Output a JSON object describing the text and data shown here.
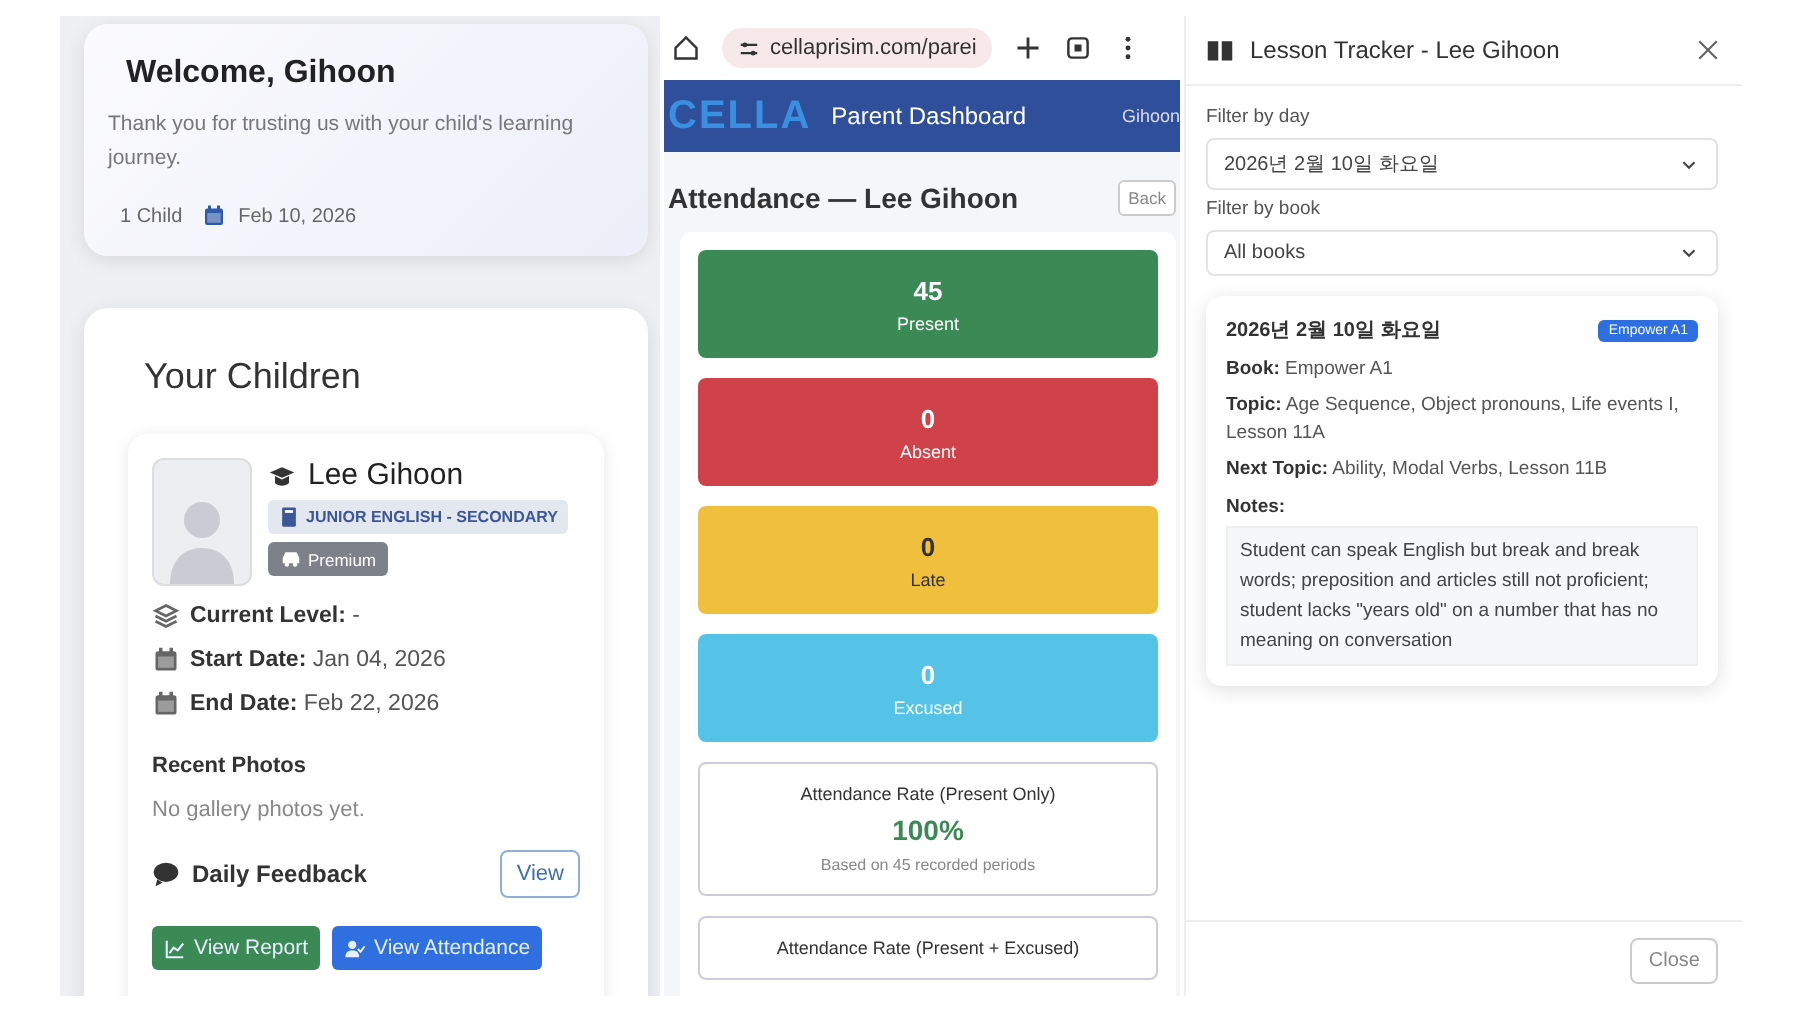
{
  "welcome": {
    "title": "Welcome, Gihoon",
    "message": "Thank you for trusting us with your child's learning journey.",
    "child_count": "1 Child",
    "date": "Feb 10, 2026"
  },
  "children": {
    "title": "Your Children",
    "child": {
      "name": "Lee Gihoon",
      "program": "JUNIOR ENGLISH - SECONDARY",
      "plan": "Premium",
      "details": [
        {
          "label": "Current Level:",
          "value": "-"
        },
        {
          "label": "Start Date:",
          "value": "Jan 04, 2026"
        },
        {
          "label": "End Date:",
          "value": "Feb 22, 2026"
        }
      ],
      "photos_title": "Recent Photos",
      "photos_empty": "No gallery photos yet.",
      "feedback_title": "Daily Feedback",
      "feedback_button": "View",
      "buttons": [
        {
          "label": "View Report",
          "color": "#3b8a55"
        },
        {
          "label": "View Attendance",
          "color": "#2f6fe0"
        }
      ]
    }
  },
  "browser": {
    "url": "cellaprisim.com/parei"
  },
  "app_header": {
    "logo": "CELLA",
    "title": "Parent Dashboard",
    "user": "Gihoon"
  },
  "attendance": {
    "title": "Attendance — Lee Gihoon",
    "back": "Back",
    "stats": [
      {
        "count": "45",
        "label": "Present",
        "color": "#3b8a55"
      },
      {
        "count": "0",
        "label": "Absent",
        "color": "#cf4249"
      },
      {
        "count": "0",
        "label": "Late",
        "color": "#f0bf3c"
      },
      {
        "count": "0",
        "label": "Excused",
        "color": "#55c3e8"
      }
    ],
    "rates": [
      {
        "title": "Attendance Rate (Present Only)",
        "value": "100%",
        "note": "Based on 45 recorded periods"
      },
      {
        "title": "Attendance Rate (Present + Excused)"
      }
    ]
  },
  "lesson_tracker": {
    "title": "Lesson Tracker - Lee Gihoon",
    "filters": [
      {
        "label": "Filter by day",
        "value": "2026년 2월 10일 화요일"
      },
      {
        "label": "Filter by book",
        "value": "All books"
      }
    ],
    "lesson": {
      "date": "2026년 2월 10일 화요일",
      "badge": "Empower A1",
      "fields": [
        {
          "text": "**Book:** Empower A1"
        },
        {
          "text": "**Topic:** Age Sequence, Object pronouns, Life events I, Lesson 11A"
        },
        {
          "text": "**Next Topic:** Ability, Modal Verbs, Lesson 11B"
        }
      ],
      "notes_label": "Notes:",
      "notes": "Student can speak English but break and break words; preposition and articles still not proficient; student lacks \"years old\" on a number that has no meaning on conversation"
    },
    "close": "Close"
  }
}
